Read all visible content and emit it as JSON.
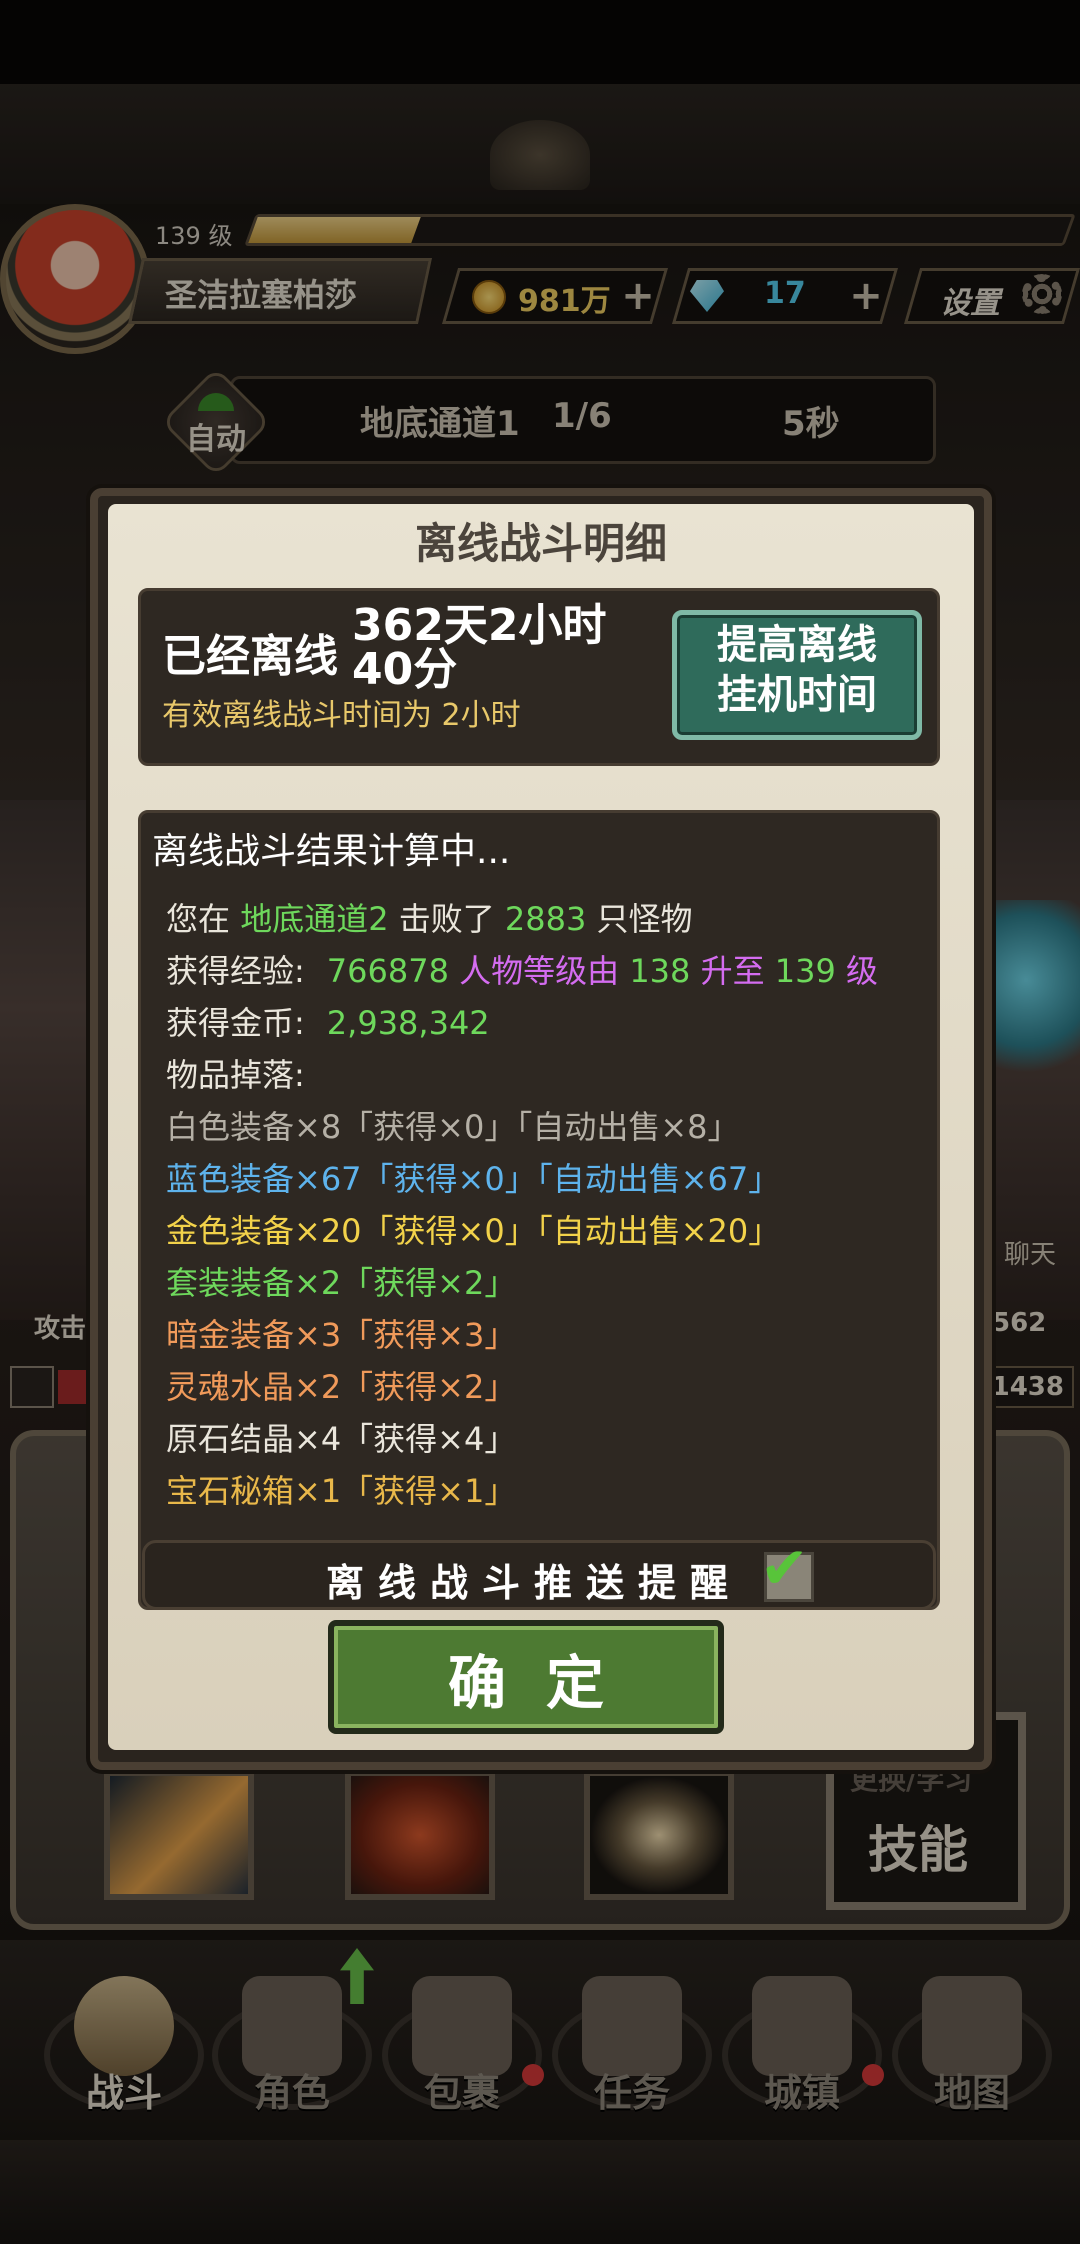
{
  "player": {
    "level": "139 级",
    "exp_fraction": 0.2,
    "name": "圣洁拉塞柏莎",
    "gold": "981万",
    "gems": "17",
    "settings_label": "设置"
  },
  "stage": {
    "auto_label": "自动",
    "name": "地底通道1",
    "progress": "1/6",
    "timer": "5秒"
  },
  "side": {
    "chat": "聊天",
    "attack": "攻击",
    "value_right": "562",
    "hp_right": "1438"
  },
  "skills": {
    "learn_label": "更换/学习",
    "skill_label": "技能"
  },
  "dialog": {
    "title": "离线战斗明细",
    "offline_label": "已经离线",
    "offline_time": "362天2小时40分",
    "effective_prefix": "有效离线战斗时间为 ",
    "effective_value": "2小时",
    "boost_line1": "提高离线",
    "boost_line2": "挂机时间",
    "results_heading": "离线战斗结果计算中...",
    "kill": {
      "prefix": "您在 ",
      "stage": "地底通道2",
      "mid": " 击败了 ",
      "count": "2883",
      "suffix": " 只怪物"
    },
    "exp": {
      "label": "获得经验:",
      "value": "766878",
      "text": " 人物等级由 ",
      "from": "138",
      "to_text": " 升至 ",
      "to": "139",
      "unit": " 级"
    },
    "gold": {
      "label": "获得金币:",
      "value": "2,938,342"
    },
    "drops_label": "物品掉落:",
    "drops": [
      "白色装备×8「获得×0」「自动出售×8」",
      "蓝色装备×67「获得×0」「自动出售×67」",
      "金色装备×20「获得×0」「自动出售×20」",
      "套装装备×2「获得×2」",
      "暗金装备×3「获得×3」",
      "灵魂水晶×2「获得×2」",
      "原石结晶×4「获得×4」",
      "宝石秘箱×1「获得×1」"
    ],
    "push_label": "离线战斗推送提醒",
    "push_checked": true,
    "confirm": "确定"
  },
  "nav": [
    {
      "label": "战斗",
      "icon": "sword-shield-icon"
    },
    {
      "label": "角色",
      "icon": "helmet-icon"
    },
    {
      "label": "包裹",
      "icon": "bag-icon"
    },
    {
      "label": "任务",
      "icon": "scroll-icon"
    },
    {
      "label": "城镇",
      "icon": "tower-icon"
    },
    {
      "label": "地图",
      "icon": "map-icon"
    }
  ],
  "colors": {
    "white_item": "#b5b0a6",
    "blue_item": "#5eb3ec",
    "gold_item": "#f2d24a",
    "set_item": "#6ed85c",
    "dark_gold_item": "#f09a5a",
    "confirm_button": "#4d7a32",
    "boost_button": "#2f6b5b"
  }
}
